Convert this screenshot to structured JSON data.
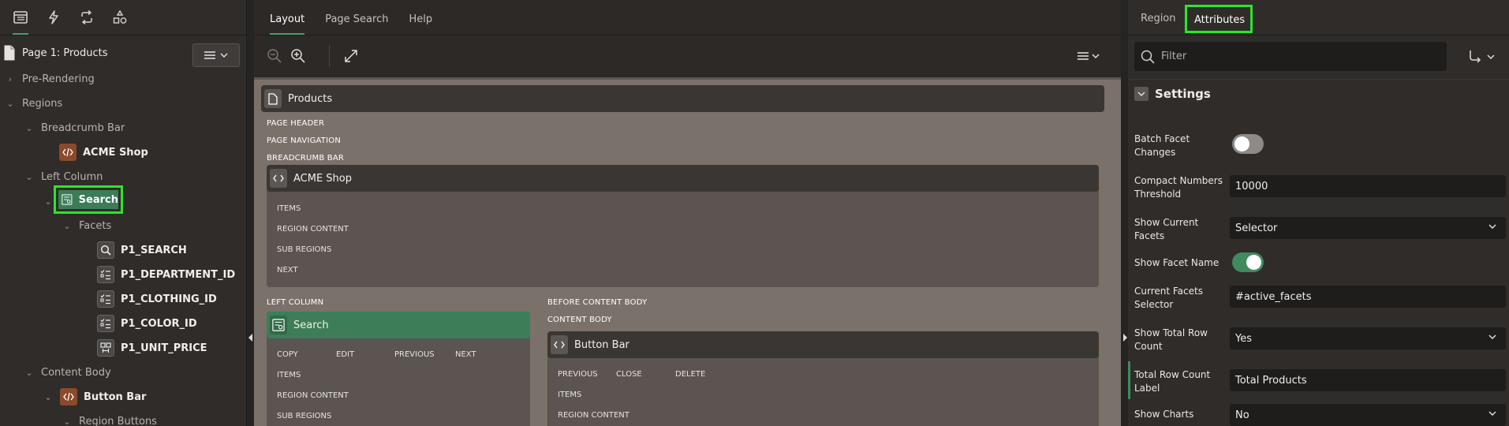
{
  "left": {
    "tabs": [
      {
        "icon": "rendering-tree-icon",
        "active": true
      },
      {
        "icon": "dynamic-actions-icon",
        "active": false
      },
      {
        "icon": "processing-icon",
        "active": false
      },
      {
        "icon": "shared-components-icon",
        "active": false
      }
    ],
    "page_label": "Page 1: Products",
    "tree": [
      {
        "label": "Pre-Rendering"
      },
      {
        "label": "Regions"
      },
      {
        "label": "Breadcrumb Bar"
      },
      {
        "label": "ACME Shop"
      },
      {
        "label": "Left Column"
      },
      {
        "label": "Search"
      },
      {
        "label": "Facets"
      },
      {
        "label": "P1_SEARCH"
      },
      {
        "label": "P1_DEPARTMENT_ID"
      },
      {
        "label": "P1_CLOTHING_ID"
      },
      {
        "label": "P1_COLOR_ID"
      },
      {
        "label": "P1_UNIT_PRICE"
      },
      {
        "label": "Content Body"
      },
      {
        "label": "Button Bar"
      },
      {
        "label": "Region Buttons"
      }
    ]
  },
  "center": {
    "tabs": [
      "Layout",
      "Page Search",
      "Help"
    ],
    "page_region": "Products",
    "labels": {
      "page_header": "PAGE HEADER",
      "page_navigation": "PAGE NAVIGATION",
      "breadcrumb_bar": "BREADCRUMB BAR",
      "left_column": "LEFT COLUMN",
      "before_content_body": "BEFORE CONTENT BODY",
      "content_body": "CONTENT BODY"
    },
    "acme_region": {
      "title": "ACME Shop",
      "slots": [
        "ITEMS",
        "REGION CONTENT",
        "SUB REGIONS",
        "NEXT"
      ]
    },
    "search_region": {
      "title": "Search",
      "buttons": [
        "COPY",
        "EDIT",
        "PREVIOUS",
        "NEXT"
      ],
      "slots": [
        "ITEMS",
        "REGION CONTENT",
        "SUB REGIONS"
      ]
    },
    "button_bar_region": {
      "title": "Button Bar",
      "buttons": [
        "PREVIOUS",
        "CLOSE",
        "DELETE"
      ],
      "slots": [
        "ITEMS",
        "REGION CONTENT"
      ]
    }
  },
  "right": {
    "tabs": [
      "Region",
      "Attributes"
    ],
    "active_tab": "Attributes",
    "filter_placeholder": "Filter",
    "section": "Settings",
    "properties": [
      {
        "label": "Batch Facet Changes",
        "type": "toggle",
        "value": "off"
      },
      {
        "label": "Compact Numbers Threshold",
        "type": "text",
        "value": "10000"
      },
      {
        "label": "Show Current Facets",
        "type": "select",
        "value": "Selector"
      },
      {
        "label": "Show Facet Name",
        "type": "toggle",
        "value": "on"
      },
      {
        "label": "Current Facets Selector",
        "type": "text",
        "value": "#active_facets"
      },
      {
        "label": "Show Total Row Count",
        "type": "select",
        "value": "Yes"
      },
      {
        "label": "Total Row Count Label",
        "type": "text",
        "value": "Total Products"
      },
      {
        "label": "Show Charts",
        "type": "select",
        "value": "No"
      }
    ]
  },
  "colors": {
    "accent_green": "#3c7c59",
    "highlight": "#2be52b",
    "region_orange": "#8b4a2b"
  }
}
